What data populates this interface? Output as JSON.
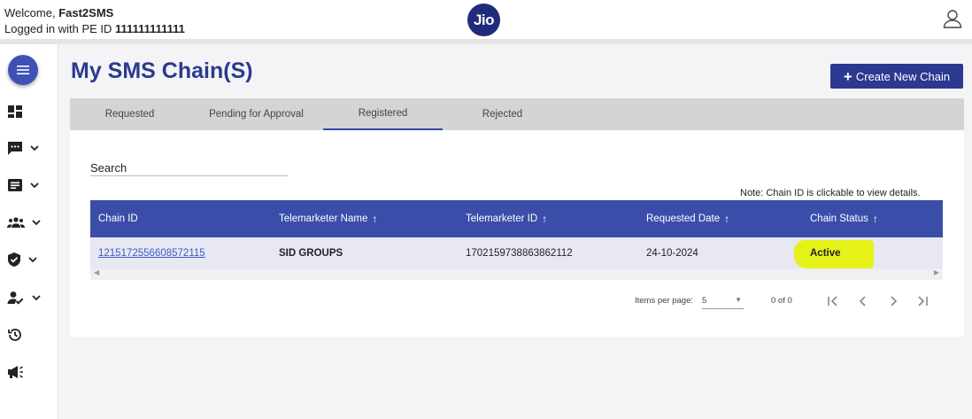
{
  "header": {
    "welcome_prefix": "Welcome,",
    "user_name": "Fast2SMS",
    "logged_prefix": "Logged in with PE ID",
    "pe_id": "111111111111",
    "logo_text": "Jio"
  },
  "sidebar": {
    "items": [
      {
        "icon": "dashboard-icon"
      },
      {
        "icon": "message-icon"
      },
      {
        "icon": "document-icon"
      },
      {
        "icon": "group-icon"
      },
      {
        "icon": "shield-check-icon"
      },
      {
        "icon": "user-check-icon"
      },
      {
        "icon": "history-icon"
      },
      {
        "icon": "megaphone-icon"
      }
    ]
  },
  "page": {
    "title": "My SMS Chain(S)",
    "create_label": "Create New Chain",
    "create_icon": "+"
  },
  "tabs": [
    {
      "label": "Requested"
    },
    {
      "label": "Pending for Approval"
    },
    {
      "label": "Registered",
      "active": true
    },
    {
      "label": "Rejected"
    }
  ],
  "search": {
    "placeholder": "Search",
    "value": ""
  },
  "note": "Note: Chain ID is clickable to view details.",
  "table": {
    "columns": [
      {
        "label": "Chain ID",
        "sortable": false
      },
      {
        "label": "Telemarketer Name",
        "sortable": true
      },
      {
        "label": "Telemarketer ID",
        "sortable": true
      },
      {
        "label": "Requested Date",
        "sortable": true
      },
      {
        "label": "Chain Status",
        "sortable": true
      }
    ],
    "sort_arrow": "↑",
    "rows": [
      {
        "chain_id": "1215172556608572115",
        "telemarketer_name": "SID GROUPS",
        "telemarketer_id": "1702159738863862112",
        "requested_date": "24-10-2024",
        "chain_status": "Active"
      }
    ]
  },
  "pagination": {
    "items_per_page_label": "Items per page:",
    "items_per_page": "5",
    "range": "0 of 0"
  },
  "colors": {
    "primary": "#2b3990",
    "header_row": "#3a4ea9",
    "highlight": "#e4f21a",
    "link": "#3b5cc4"
  }
}
